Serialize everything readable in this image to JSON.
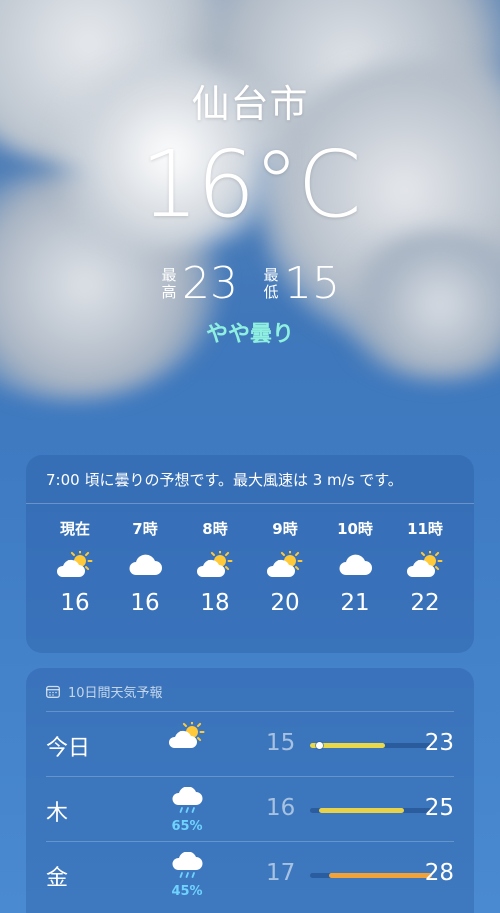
{
  "location": {
    "city": "仙台市",
    "current_temp": "16°C",
    "condition": "やや曇り"
  },
  "hilo": {
    "high_label": "最高",
    "high": "23",
    "low_label": "最低",
    "low": "15"
  },
  "hourly": {
    "summary": "7:00 頃に曇りの予想です。最大風速は 3 m/s です。",
    "items": [
      {
        "label": "現在",
        "icon": "partly-cloudy-sun-icon",
        "temp": "16"
      },
      {
        "label": "7時",
        "icon": "cloud-icon",
        "temp": "16"
      },
      {
        "label": "8時",
        "icon": "partly-cloudy-sun-icon",
        "temp": "18"
      },
      {
        "label": "9時",
        "icon": "partly-cloudy-sun-icon",
        "temp": "20"
      },
      {
        "label": "10時",
        "icon": "cloud-icon",
        "temp": "21"
      },
      {
        "label": "11時",
        "icon": "partly-cloudy-sun-icon",
        "temp": "22"
      }
    ]
  },
  "daily": {
    "title": "10日間天気予報",
    "range": [
      15,
      28
    ],
    "days": [
      {
        "name": "今日",
        "icon": "partly-cloudy-sun-icon",
        "pop": "",
        "low": "15",
        "high": "23",
        "low_val": 15,
        "high_val": 23,
        "current_val": 16,
        "bar_color": "#e9d94a"
      },
      {
        "name": "木",
        "icon": "rain-cloud-icon",
        "pop": "65%",
        "low": "16",
        "high": "25",
        "low_val": 16,
        "high_val": 25,
        "bar_color": "#e7d24a"
      },
      {
        "name": "金",
        "icon": "rain-cloud-icon",
        "pop": "45%",
        "low": "17",
        "high": "28",
        "low_val": 17,
        "high_val": 28,
        "bar_color": "#f1a33a"
      }
    ]
  },
  "colors": {
    "condition": "#8ff0e0",
    "precip": "#6fd2ff",
    "sun": "#ffc93a"
  }
}
